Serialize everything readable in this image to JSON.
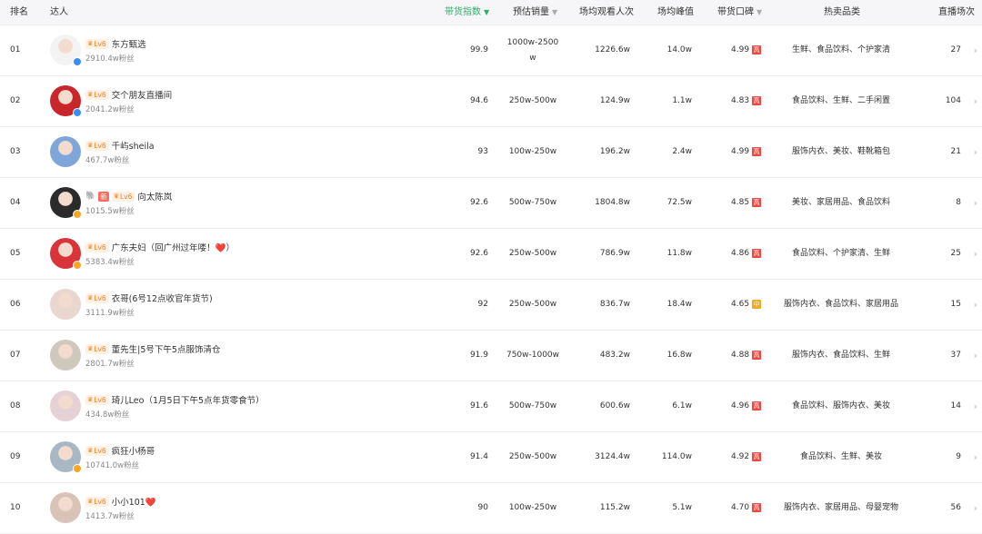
{
  "header": {
    "rank": "排名",
    "creator": "达人",
    "sales_index": "带货指数",
    "est_sales": "预估销量",
    "avg_viewers": "场均观看人次",
    "avg_peak": "场均峰值",
    "reputation": "带货口碑",
    "hot_categories": "热卖品类",
    "live_count": "直播场次",
    "active_color": "#27b268"
  },
  "level_label": "Lv6",
  "new_label": "新",
  "rows": [
    {
      "rank": "01",
      "name": "东方甄选",
      "fans": "2910.4w粉丝",
      "index": "99.9",
      "sales_l1": "1000w-2500",
      "sales_l2": "w",
      "viewers": "1226.6w",
      "peak": "14.0w",
      "score": "4.99",
      "tag": "高",
      "tag_type": "high",
      "cats": "生鲜、食品饮料、个护家清",
      "count": "27",
      "avatar_bg": "#f3f3f3",
      "verified": "#3a8ef6"
    },
    {
      "rank": "02",
      "name": "交个朋友直播间",
      "fans": "2041.2w粉丝",
      "index": "94.6",
      "sales_l1": "250w-500w",
      "sales_l2": "",
      "viewers": "124.9w",
      "peak": "1.1w",
      "score": "4.83",
      "tag": "高",
      "tag_type": "high",
      "cats": "食品饮料、生鲜、二手闲置",
      "count": "104",
      "avatar_bg": "#c8262b",
      "verified": "#3a8ef6"
    },
    {
      "rank": "03",
      "name": "千屿sheila",
      "fans": "467.7w粉丝",
      "index": "93",
      "sales_l1": "100w-250w",
      "sales_l2": "",
      "viewers": "196.2w",
      "peak": "2.4w",
      "score": "4.99",
      "tag": "高",
      "tag_type": "high",
      "cats": "服饰内衣、美妆、鞋靴箱包",
      "count": "21",
      "avatar_bg": "#7fa6d8",
      "verified": ""
    },
    {
      "rank": "04",
      "name": "向太陈岚",
      "fans": "1015.5w粉丝",
      "index": "92.6",
      "sales_l1": "500w-750w",
      "sales_l2": "",
      "viewers": "1804.8w",
      "peak": "72.5w",
      "score": "4.85",
      "tag": "高",
      "tag_type": "high",
      "cats": "美妆、家居用品、食品饮料",
      "count": "8",
      "avatar_bg": "#2b2b2b",
      "verified": "#f5a623"
    },
    {
      "rank": "05",
      "name": "广东夫妇（回广州过年喽！❤️）",
      "fans": "5383.4w粉丝",
      "index": "92.6",
      "sales_l1": "250w-500w",
      "sales_l2": "",
      "viewers": "786.9w",
      "peak": "11.8w",
      "score": "4.86",
      "tag": "高",
      "tag_type": "high",
      "cats": "食品饮料、个护家清、生鲜",
      "count": "25",
      "avatar_bg": "#d8343a",
      "verified": "#f5a623"
    },
    {
      "rank": "06",
      "name": "衣哥(6号12点收官年货节)",
      "fans": "3111.9w粉丝",
      "index": "92",
      "sales_l1": "250w-500w",
      "sales_l2": "",
      "viewers": "836.7w",
      "peak": "18.4w",
      "score": "4.65",
      "tag": "中",
      "tag_type": "mid",
      "cats": "服饰内衣、食品饮料、家居用品",
      "count": "15",
      "avatar_bg": "#e9d6cf",
      "verified": ""
    },
    {
      "rank": "07",
      "name": "董先生|5号下午5点服饰清仓",
      "fans": "2801.7w粉丝",
      "index": "91.9",
      "sales_l1": "750w-1000w",
      "sales_l2": "",
      "viewers": "483.2w",
      "peak": "16.8w",
      "score": "4.88",
      "tag": "高",
      "tag_type": "high",
      "cats": "服饰内衣、食品饮料、生鲜",
      "count": "37",
      "avatar_bg": "#cfc8bd",
      "verified": ""
    },
    {
      "rank": "08",
      "name": "琦儿Leo（1月5日下午5点年货零食节）",
      "fans": "434.8w粉丝",
      "index": "91.6",
      "sales_l1": "500w-750w",
      "sales_l2": "",
      "viewers": "600.6w",
      "peak": "6.1w",
      "score": "4.96",
      "tag": "高",
      "tag_type": "high",
      "cats": "食品饮料、服饰内衣、美妆",
      "count": "14",
      "avatar_bg": "#e6d2d6",
      "verified": ""
    },
    {
      "rank": "09",
      "name": "疯狂小杨哥",
      "fans": "10741.0w粉丝",
      "index": "91.4",
      "sales_l1": "250w-500w",
      "sales_l2": "",
      "viewers": "3124.4w",
      "peak": "114.0w",
      "score": "4.92",
      "tag": "高",
      "tag_type": "high",
      "cats": "食品饮料、生鲜、美妆",
      "count": "9",
      "avatar_bg": "#a7b7c4",
      "verified": "#f5a623"
    },
    {
      "rank": "10",
      "name": "小小101❤️",
      "fans": "1413.7w粉丝",
      "index": "90",
      "sales_l1": "100w-250w",
      "sales_l2": "",
      "viewers": "115.2w",
      "peak": "5.1w",
      "score": "4.70",
      "tag": "高",
      "tag_type": "high",
      "cats": "服饰内衣、家居用品、母婴宠物",
      "count": "56",
      "avatar_bg": "#d9c3b8",
      "verified": ""
    }
  ],
  "badge_row4_icon": "pet-icon"
}
